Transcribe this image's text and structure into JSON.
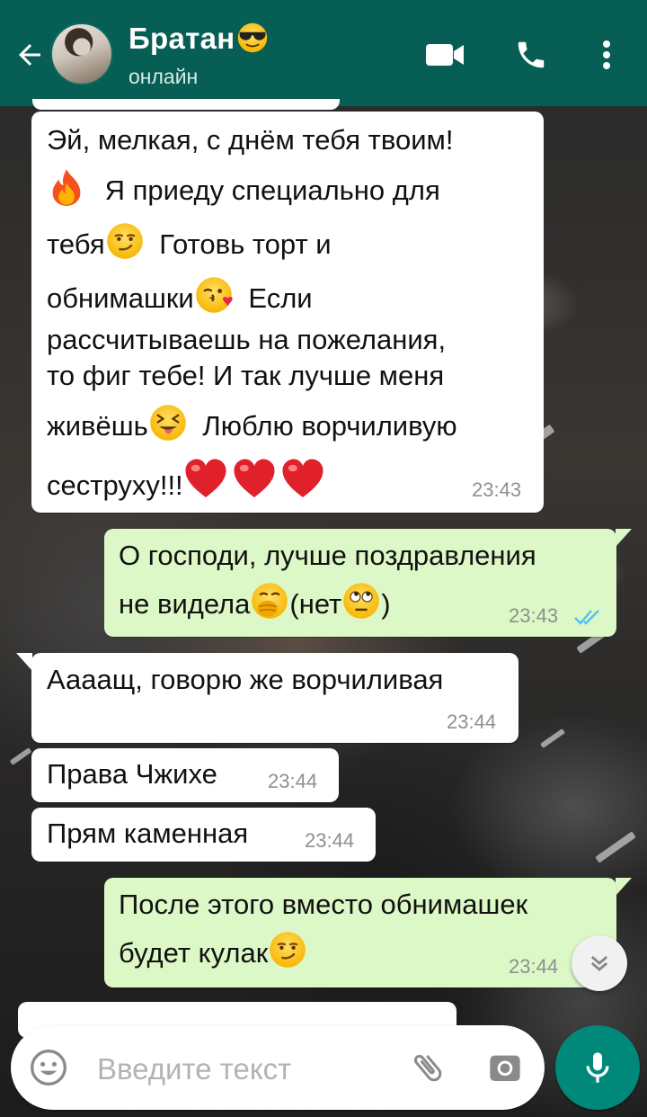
{
  "header": {
    "contact_name": "Братан",
    "name_emoji": "smiling-face-with-sunglasses",
    "status": "онлайн",
    "colors": {
      "bar": "#075e54",
      "text": "#ffffff"
    },
    "icons": [
      "back-arrow-icon",
      "video-call-icon",
      "phone-call-icon",
      "more-options-icon"
    ]
  },
  "messages": [
    {
      "direction": "incoming",
      "lines": [
        "Эй, мелкая, с днём тебя твоим!",
        "Я приеду специально для",
        "тебя",
        "Готовь торт и",
        "обнимашки",
        "Если",
        "рассчитываешь на пожелания,",
        "то фиг тебе! И так лучше меня",
        "живёшь",
        "Люблю ворчиливую",
        "сеструху!!!"
      ],
      "emojis": [
        "fire",
        "smirking-face",
        "face-blowing-kiss",
        "squinting-face-with-tongue",
        "red-heart",
        "red-heart",
        "red-heart"
      ],
      "time": "23:43"
    },
    {
      "direction": "outgoing",
      "lines": [
        "О господи, лучше поздравления",
        "не видела",
        "(нет",
        ")"
      ],
      "emojis": [
        "face-with-hand-over-mouth",
        "face-with-rolling-eyes"
      ],
      "time": "23:43",
      "status": "read"
    },
    {
      "direction": "incoming",
      "lines": [
        "Аааащ, говорю же ворчиливая"
      ],
      "time": "23:44"
    },
    {
      "direction": "incoming",
      "lines": [
        "Права Чжихе"
      ],
      "time": "23:44"
    },
    {
      "direction": "incoming",
      "lines": [
        "Прям каменная"
      ],
      "time": "23:44"
    },
    {
      "direction": "outgoing",
      "lines": [
        "После этого вместо обнимашек",
        "будет кулак"
      ],
      "emojis": [
        "smirking-face"
      ],
      "time": "23:44"
    }
  ],
  "input": {
    "placeholder": "Введите текст",
    "icons": [
      "emoji-icon",
      "attach-icon",
      "camera-icon",
      "mic-icon"
    ]
  },
  "scroll_down_icon": "double-chevron-down-icon",
  "colors": {
    "incoming_bubble": "#ffffff",
    "outgoing_bubble": "#dcf8c6",
    "read_ticks": "#4fc3f7",
    "mic_button": "#00897b"
  }
}
